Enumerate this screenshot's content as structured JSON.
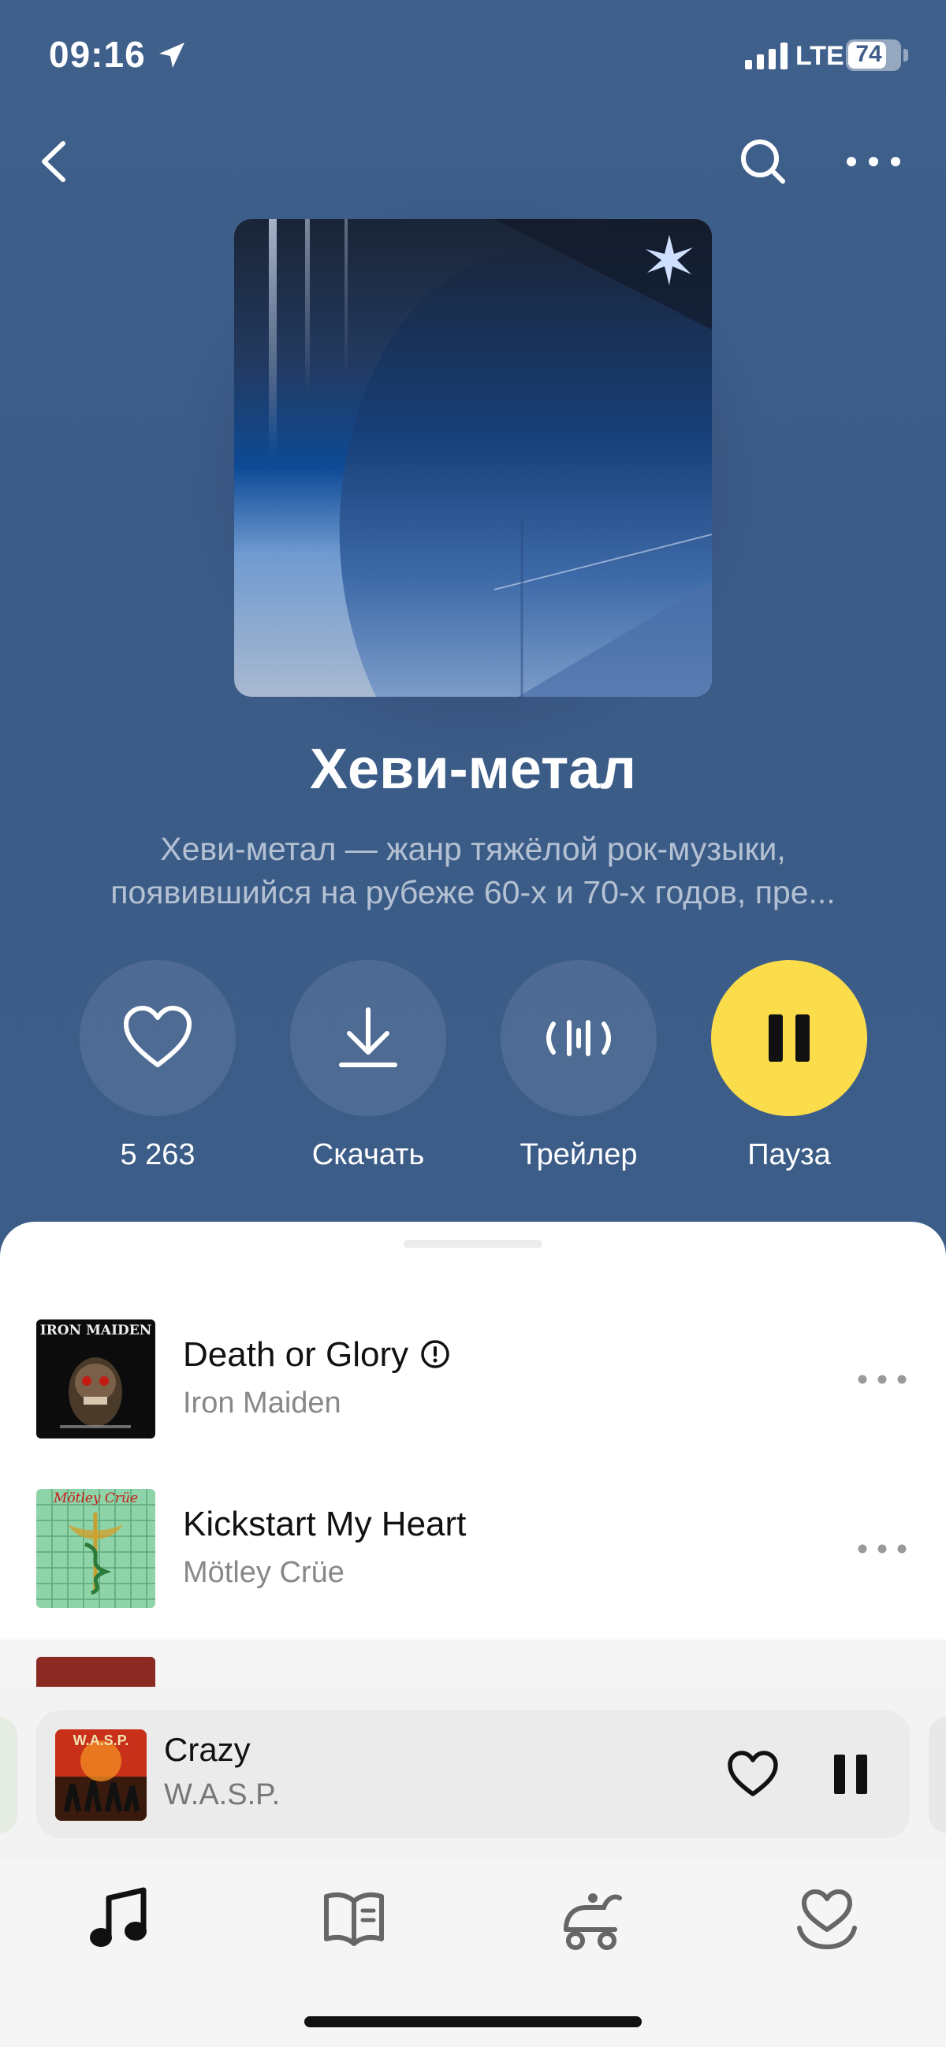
{
  "status_bar": {
    "time": "09:16",
    "network": "LTE",
    "battery": "74",
    "icons": [
      "location-arrow-icon",
      "signal-bars-icon",
      "battery-icon"
    ]
  },
  "nav": {
    "icons": [
      "back-chevron-icon",
      "search-icon",
      "more-dots-icon"
    ]
  },
  "playlist": {
    "title": "Хеви-метал",
    "description_line1": "Хеви-метал — жанр тяжёлой рок-музыки,",
    "description_line2": "появившийся на рубеже 60-х и 70-х годов, пре..."
  },
  "actions": {
    "like_count": "5 263",
    "download_label": "Скачать",
    "trailer_label": "Трейлер",
    "pause_label": "Пауза",
    "icons": [
      "heart-icon",
      "download-icon",
      "soundwave-icon",
      "pause-icon"
    ]
  },
  "tracks": [
    {
      "title": "Death or Glory",
      "artist": "Iron Maiden",
      "explicit": true,
      "art_text": "IRON MAIDEN"
    },
    {
      "title": "Kickstart My Heart",
      "artist": "Mötley Crüe",
      "explicit": false,
      "art_text": "Mötley Crüe"
    }
  ],
  "now_playing": {
    "title": "Crazy",
    "artist": "W.A.S.P.",
    "art_text": "W.A.S.P."
  },
  "tab_bar": {
    "tabs": [
      "music-note-icon",
      "book-icon",
      "kids-icon",
      "heart-collection-icon"
    ]
  },
  "colors": {
    "header_bg": "#3f5f8a",
    "accent_yellow": "#fbdc4b",
    "sheet_bg": "#ffffff"
  }
}
